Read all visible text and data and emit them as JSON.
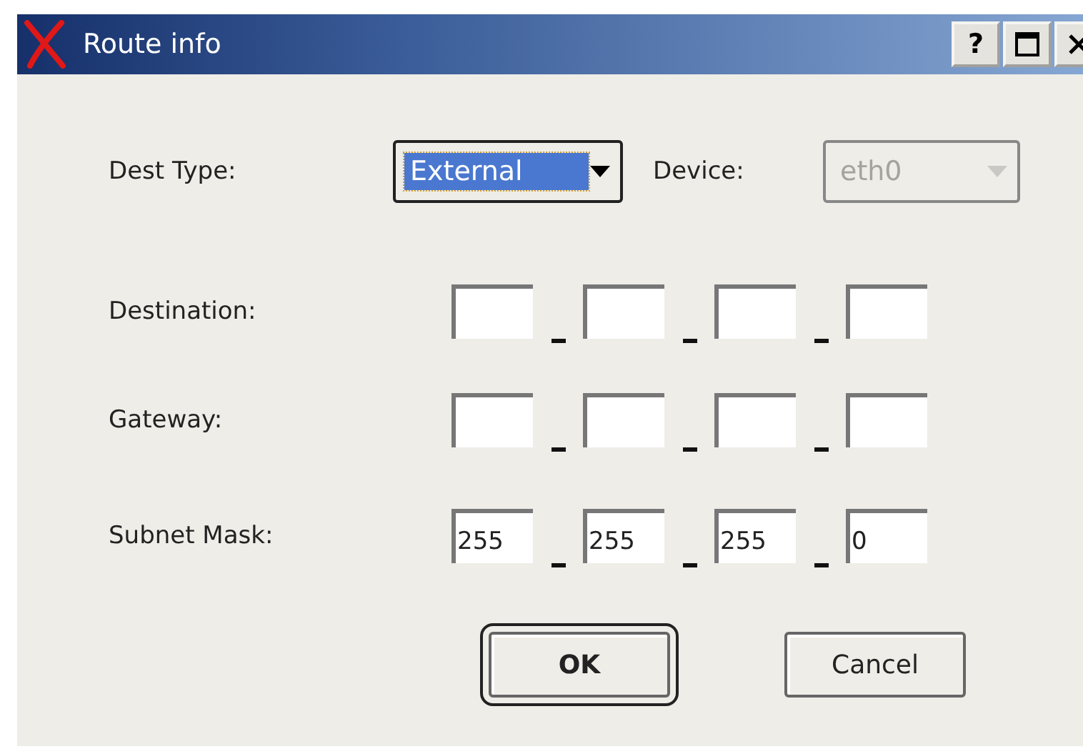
{
  "window": {
    "title": "Route info",
    "help_button": "?"
  },
  "dest_type": {
    "label": "Dest Type:",
    "value": "External",
    "focused": true,
    "disabled": false
  },
  "device": {
    "label": "Device:",
    "value": "eth0",
    "disabled": true
  },
  "address_rows": [
    {
      "label": "Destination:",
      "octets": [
        {
          "kind": "blank"
        },
        {
          "kind": "blank"
        },
        {
          "kind": "blank"
        },
        {
          "kind": "blank"
        }
      ]
    },
    {
      "label": "Gateway:",
      "octets": [
        {
          "kind": "blank"
        },
        {
          "kind": "blank"
        },
        {
          "kind": "blank"
        },
        {
          "kind": "blank"
        }
      ]
    },
    {
      "label": "Subnet Mask:",
      "octets": [
        {
          "kind": "filled",
          "value": "255"
        },
        {
          "kind": "filled",
          "value": "255"
        },
        {
          "kind": "filled",
          "value": "255"
        },
        {
          "kind": "filled",
          "value": "0"
        }
      ]
    }
  ],
  "buttons": [
    {
      "label": "OK",
      "default": true
    },
    {
      "label": "Cancel",
      "default": false
    }
  ]
}
